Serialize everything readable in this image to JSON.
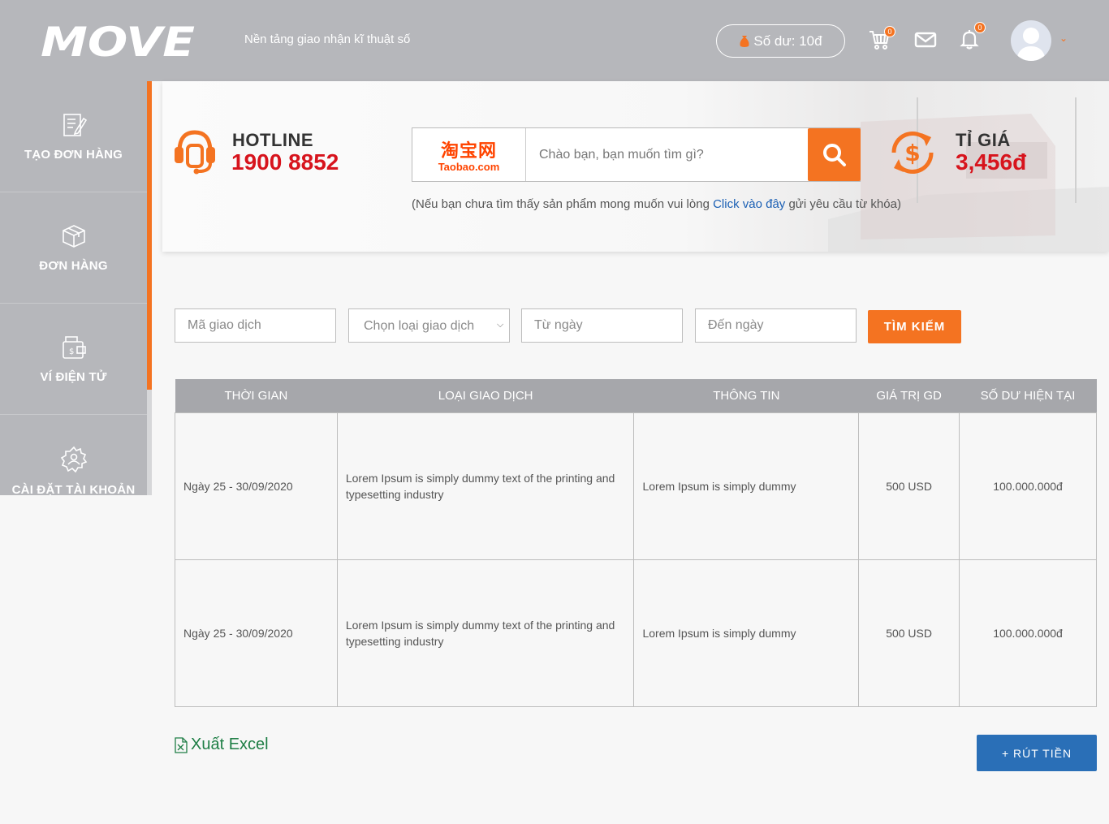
{
  "header": {
    "logo_text": "MOVE",
    "tagline": "Nền tảng giao nhận kĩ thuật số",
    "balance": "Số dư: 10đ",
    "cart_count": "0",
    "notification_count": "0"
  },
  "sidebar": {
    "items": [
      {
        "label": "TẠO ĐƠN HÀNG",
        "icon": "edit-order-icon"
      },
      {
        "label": "ĐƠN HÀNG",
        "icon": "box-icon"
      },
      {
        "label": "VÍ ĐIỆN TỬ",
        "icon": "wallet-icon"
      },
      {
        "label": "CÀI ĐẶT TÀI KHOẢN",
        "icon": "settings-icon"
      }
    ]
  },
  "banner": {
    "hotline_label": "HOTLINE",
    "hotline_number": "1900 8852",
    "search_brand_cn": "淘宝网",
    "search_brand_en": "Taobao.com",
    "search_placeholder": "Chào bạn, bạn muốn tìm gì?",
    "hint_before": "(Nếu bạn chưa tìm thấy sản phẩm mong muốn vui lòng ",
    "hint_link": "Click vào đây",
    "hint_after": " gửi yêu cầu từ khóa)",
    "rate_label": "TỈ GIÁ",
    "rate_value": "3,456đ"
  },
  "filters": {
    "transaction_code_placeholder": "Mã giao dịch",
    "transaction_type_selected": "Chọn loại giao dịch",
    "from_date_placeholder": "Từ ngày",
    "to_date_placeholder": "Đến ngày",
    "search_button": "TÌM KIẾM"
  },
  "table": {
    "headers": [
      "THỜI GIAN",
      "LOẠI GIAO DỊCH",
      "THÔNG TIN",
      "GIÁ TRỊ GD",
      "SỐ DƯ HIỆN TẠI"
    ],
    "rows": [
      [
        "Ngày 25 - 30/09/2020",
        "Lorem Ipsum is simply dummy text of the printing and typesetting industry",
        "Lorem Ipsum is simply dummy",
        "500 USD",
        "100.000.000đ"
      ],
      [
        "Ngày 25 - 30/09/2020",
        "Lorem Ipsum is simply dummy text of the printing and typesetting industry",
        "Lorem Ipsum is simply dummy",
        "500 USD",
        "100.000.000đ"
      ]
    ]
  },
  "footer": {
    "export_label": "Xuất Excel",
    "withdraw_label": "+ RÚT TIỀN"
  },
  "colors": {
    "accent": "#f47321",
    "header_bg": "#b6b7bb",
    "hotline_red": "#d7141d",
    "excel_green": "#1e7e45",
    "withdraw_blue": "#2a6fb7"
  }
}
